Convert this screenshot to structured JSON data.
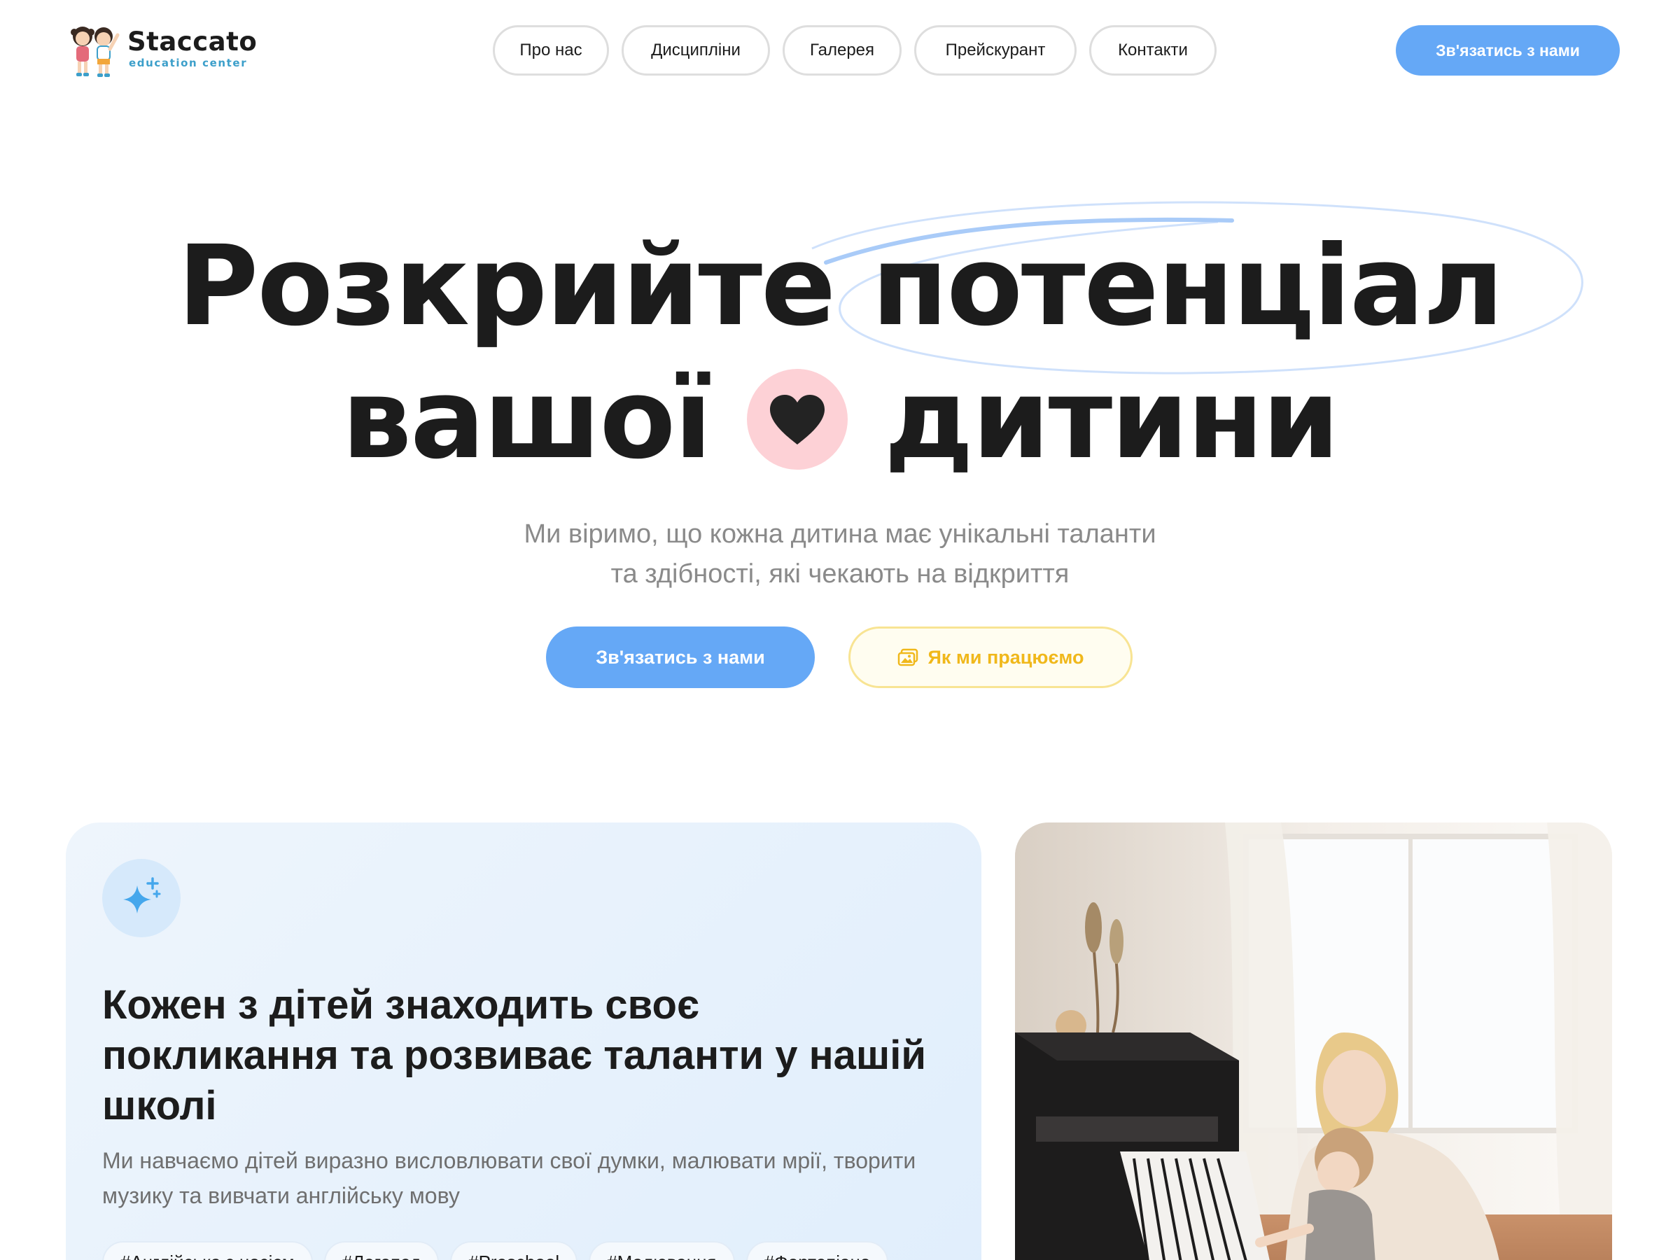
{
  "logo": {
    "name": "Staccato",
    "subtitle": "education center"
  },
  "nav": {
    "items": [
      {
        "label": "Про нас"
      },
      {
        "label": "Дисципліни"
      },
      {
        "label": "Галерея"
      },
      {
        "label": "Прейскурант"
      },
      {
        "label": "Контакти"
      }
    ],
    "cta_label": "Зв'язатись з нами"
  },
  "hero": {
    "title_line1": "Розкрийте потенціал",
    "title_line2_left": "вашої",
    "title_line2_right": "дитини",
    "subtitle_line1": "Ми віримо, що кожна дитина має унікальні таланти",
    "subtitle_line2": "та здібності, які чекають на відкриття",
    "primary_button": "Зв'язатись з нами",
    "secondary_button": "Як ми працюємо",
    "heart_icon": "heart-icon"
  },
  "feature_card": {
    "icon": "sparkles-icon",
    "title": "Кожен з дітей знаходить своє покликання та розвиває таланти у нашій школі",
    "text": "Ми навчаємо дітей виразно висловлювати свої думки, малювати мрії, творити музику та вивчати англійську мову",
    "tags": [
      "#Англійська з носієм",
      "#Логопед",
      "#Preschool",
      "#Малювання",
      "#Фортепіано"
    ]
  },
  "photo": {
    "subject": "mother and child playing piano"
  },
  "colors": {
    "accent_blue": "#65a8f6",
    "accent_yellow": "#f0b81b",
    "heart_bg": "#fdd1d6",
    "card_bg": "#e6f1fc",
    "text_dark": "#1c1c1c",
    "text_muted": "#8a8a8a"
  }
}
